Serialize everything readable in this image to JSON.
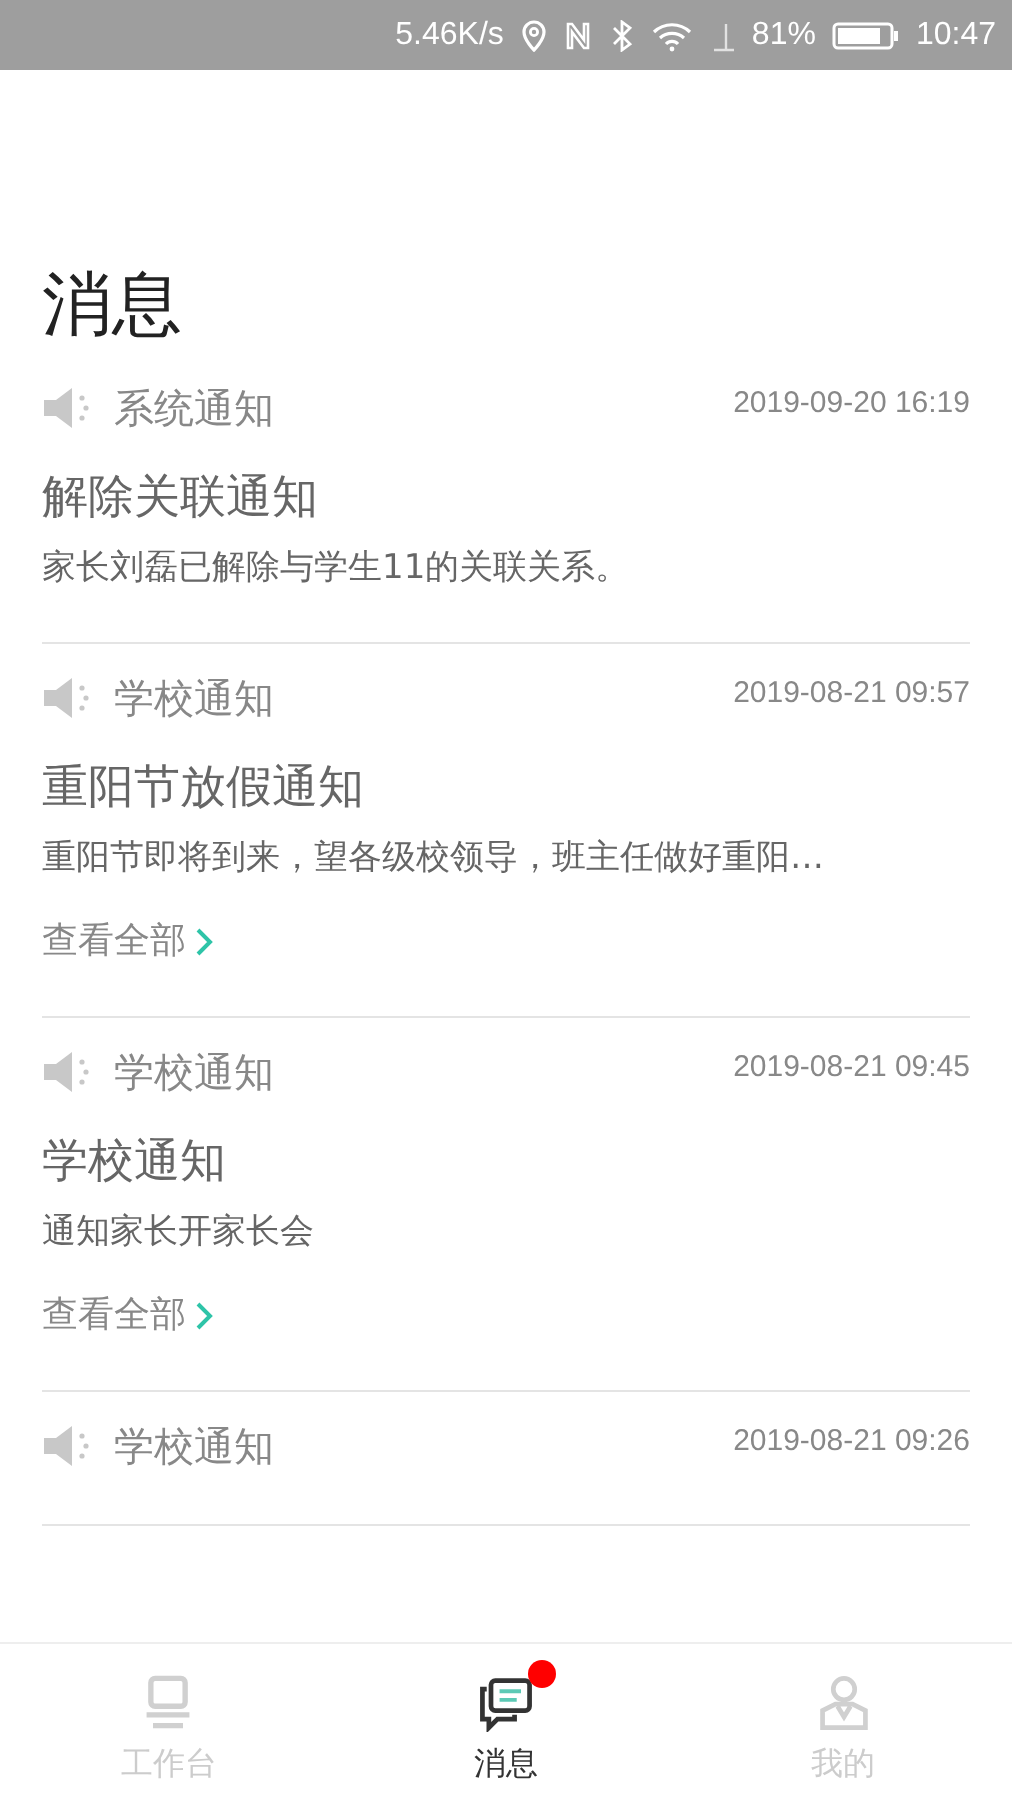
{
  "status_bar": {
    "speed": "5.46K/s",
    "battery": "81%",
    "time": "10:47"
  },
  "page_title": "消息",
  "messages": [
    {
      "category": "系统通知",
      "time": "2019-09-20 16:19",
      "title": "解除关联通知",
      "body": "家长刘磊已解除与学生11的关联关系。"
    },
    {
      "category": "学校通知",
      "time": "2019-08-21 09:57",
      "title": "重阳节放假通知",
      "body": "重阳节即将到来，望各级校领导，班主任做好重阳…",
      "more": "查看全部"
    },
    {
      "category": "学校通知",
      "time": "2019-08-21 09:45",
      "title": "学校通知",
      "body": "通知家长开家长会",
      "more": "查看全部"
    },
    {
      "category": "学校通知",
      "time": "2019-08-21 09:26"
    }
  ],
  "tab_bar": [
    {
      "kind": "workbench",
      "label": "工作台",
      "selected": false,
      "badge": false
    },
    {
      "kind": "messages",
      "label": "消息",
      "selected": true,
      "badge": true
    },
    {
      "kind": "profile",
      "label": "我的",
      "selected": false,
      "badge": false
    }
  ]
}
